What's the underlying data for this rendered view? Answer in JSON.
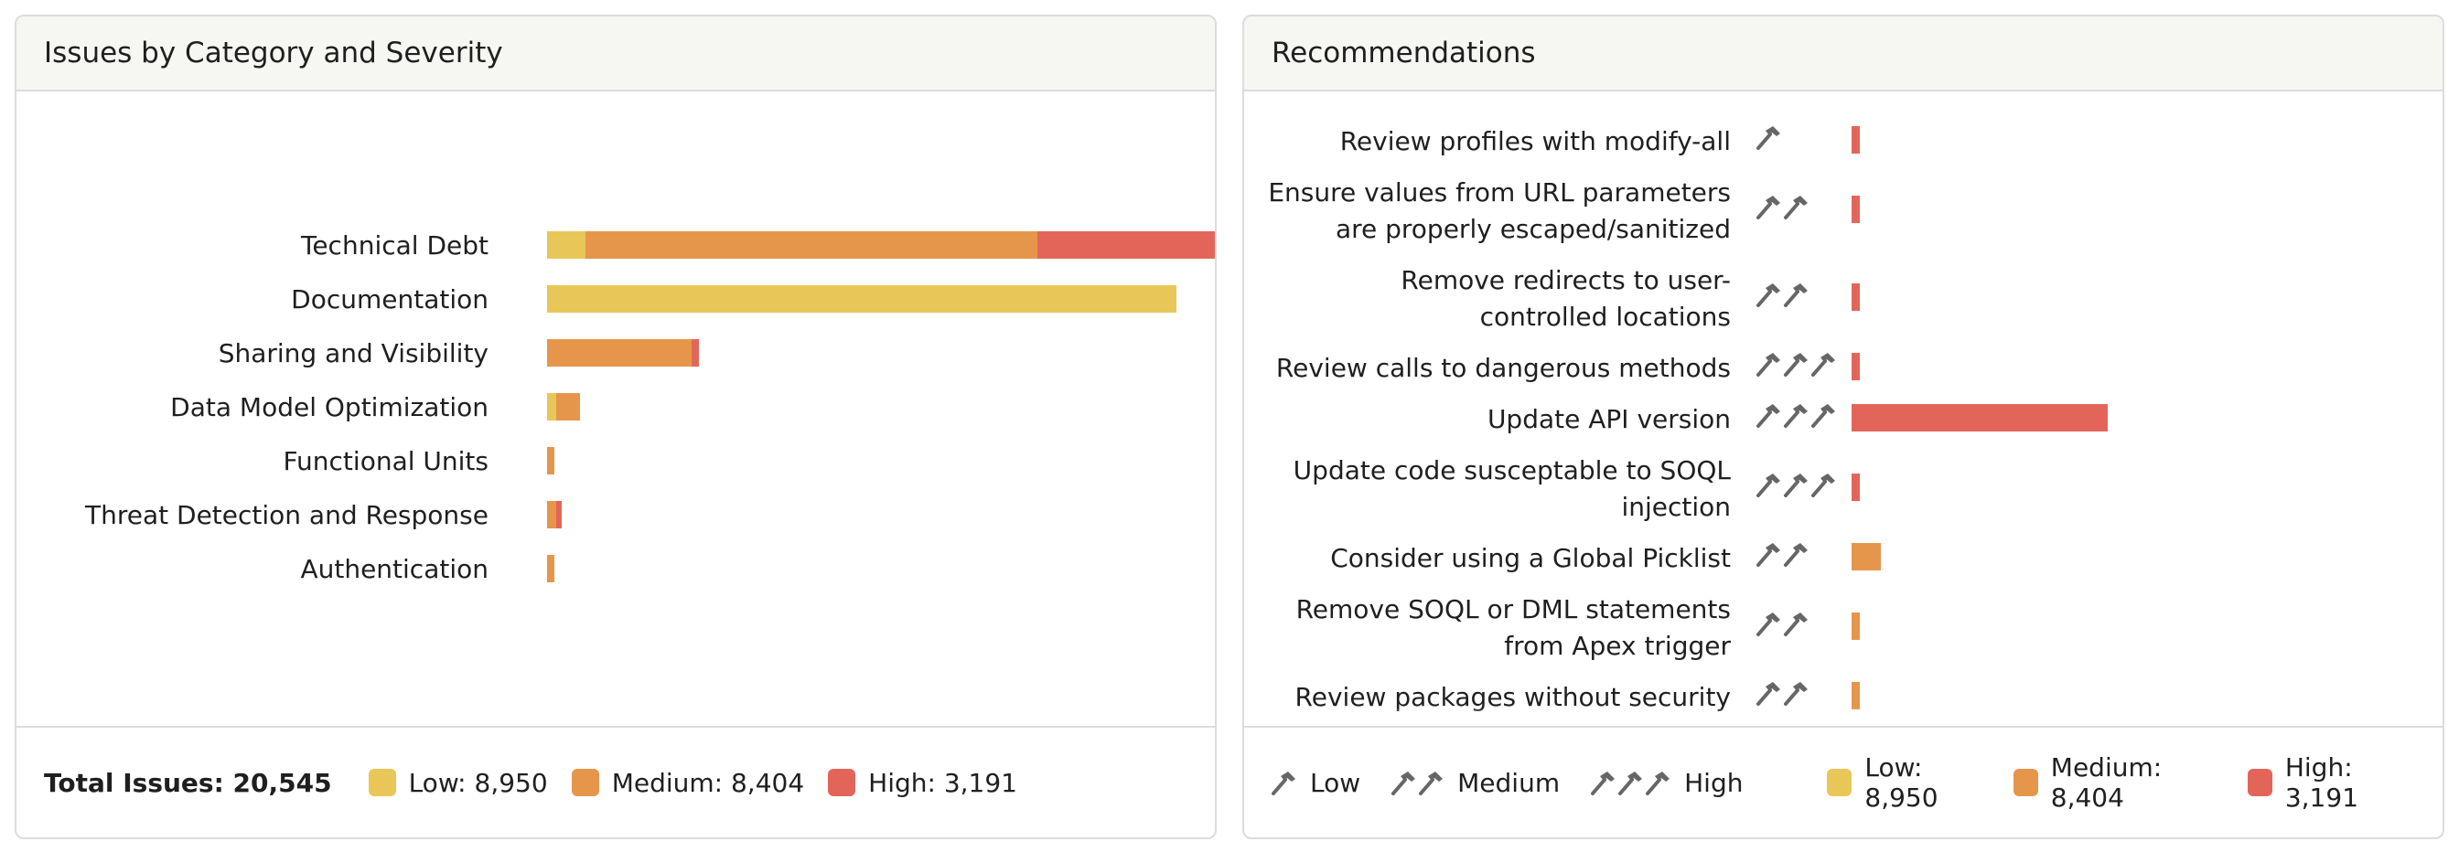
{
  "left_panel": {
    "title": "Issues by Category and Severity",
    "footer": {
      "total": "Total Issues: 20,545",
      "legend": [
        {
          "label": "Low: 8,950",
          "color": "#e8c758"
        },
        {
          "label": "Medium: 8,404",
          "color": "#e6964b"
        },
        {
          "label": "High: 3,191",
          "color": "#e3655a"
        }
      ]
    }
  },
  "right_panel": {
    "title": "Recommendations",
    "footer": {
      "effort_legend": [
        {
          "label": "Low",
          "hammers": 1
        },
        {
          "label": "Medium",
          "hammers": 2
        },
        {
          "label": "High",
          "hammers": 3
        }
      ],
      "legend": [
        {
          "label": "Low: 8,950",
          "color": "#e8c758"
        },
        {
          "label": "Medium: 8,404",
          "color": "#e6964b"
        },
        {
          "label": "High: 3,191",
          "color": "#e3655a"
        }
      ]
    }
  },
  "colors": {
    "low": "#e8c758",
    "medium": "#e6964b",
    "high": "#e3655a",
    "hammer": "#666666"
  },
  "chart_data": [
    {
      "type": "bar",
      "orientation": "horizontal",
      "stacked": true,
      "title": "Issues by Category and Severity",
      "categories": [
        "Technical Debt",
        "Documentation",
        "Sharing and Visibility",
        "Data Model Optimization",
        "Functional Units",
        "Threat Detection and Response",
        "Authentication"
      ],
      "series": [
        {
          "name": "Low",
          "values": [
            420,
            6880,
            0,
            100,
            0,
            0,
            0
          ]
        },
        {
          "name": "Medium",
          "values": [
            4940,
            0,
            1580,
            260,
            80,
            100,
            80
          ]
        },
        {
          "name": "High",
          "values": [
            2480,
            0,
            80,
            0,
            0,
            60,
            0
          ]
        }
      ],
      "xlim": [
        0,
        8000
      ]
    },
    {
      "type": "bar",
      "orientation": "horizontal",
      "title": "Recommendations",
      "categories": [
        [
          "Review profiles with modify-all"
        ],
        [
          "Ensure values from URL parameters",
          "are properly escaped/sanitized"
        ],
        [
          "Remove redirects to user-",
          "controlled locations"
        ],
        [
          "Review calls to dangerous methods"
        ],
        [
          "Update API version"
        ],
        [
          "Update code susceptable to SOQL",
          "injection"
        ],
        [
          "Consider using a Global Picklist"
        ],
        [
          "Remove SOQL or DML statements",
          "from Apex trigger"
        ],
        [
          "Review packages without security"
        ]
      ],
      "effort": [
        1,
        2,
        2,
        3,
        3,
        3,
        2,
        2,
        2
      ],
      "severity": [
        "high",
        "high",
        "high",
        "high",
        "high",
        "high",
        "medium",
        "medium",
        "medium"
      ],
      "values": [
        90,
        90,
        90,
        90,
        2800,
        90,
        320,
        90,
        90
      ],
      "xlim": [
        0,
        8000
      ]
    }
  ]
}
